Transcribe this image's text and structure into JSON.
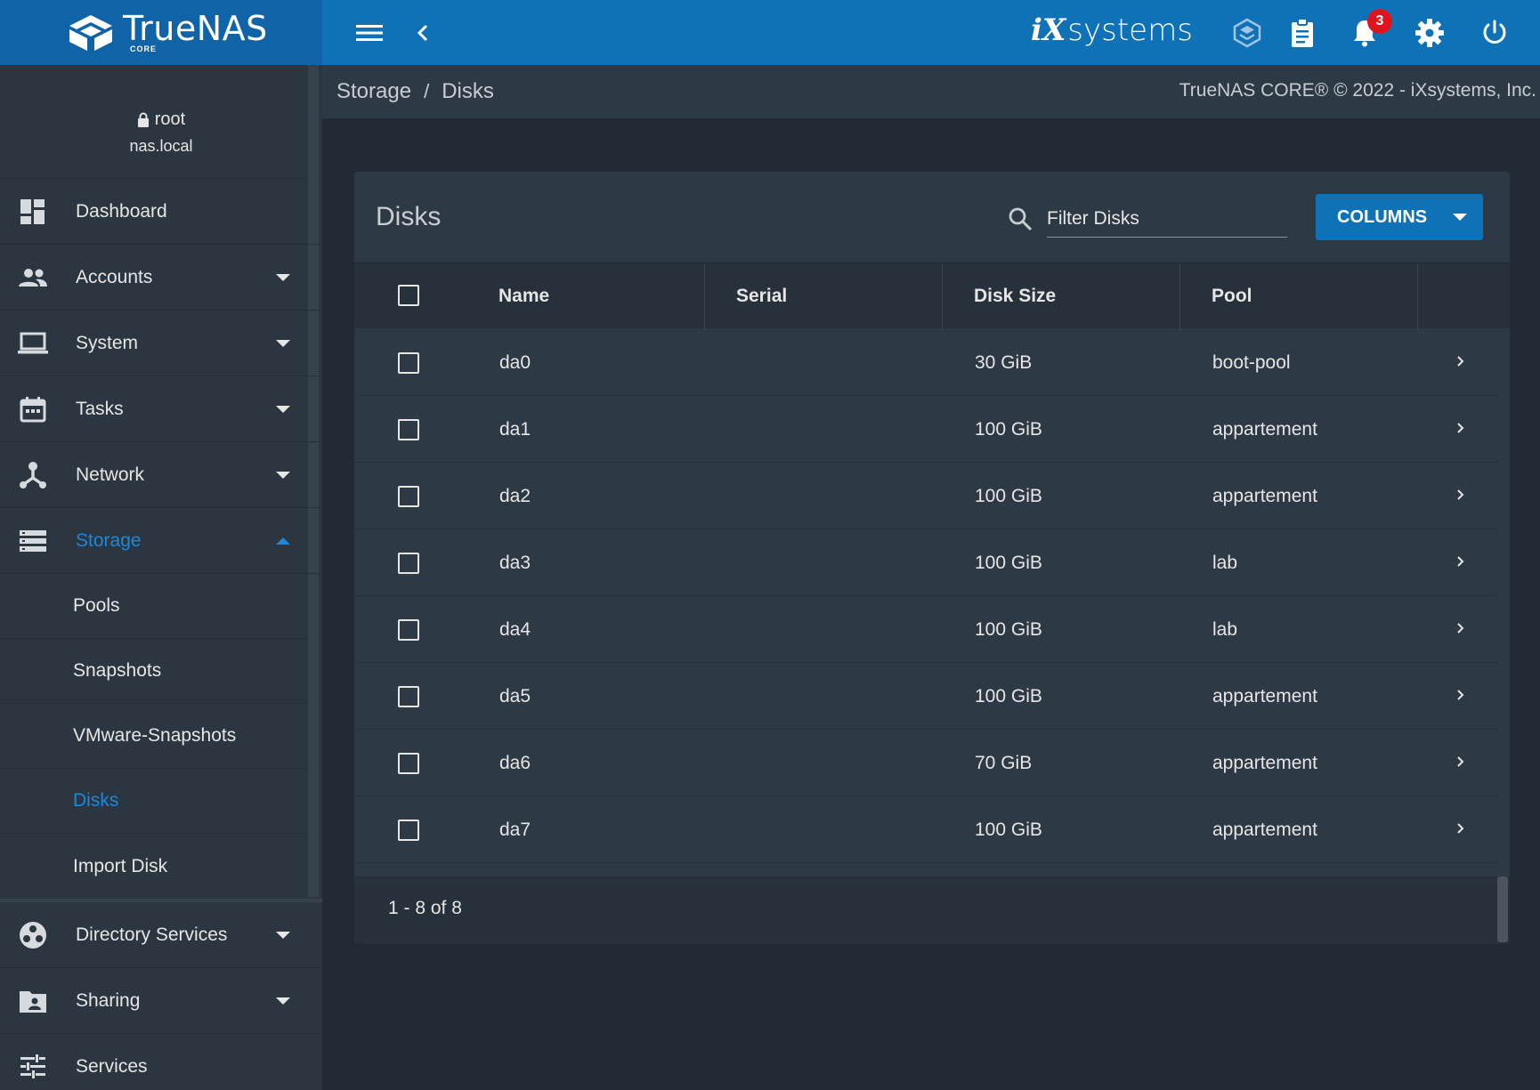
{
  "topbar": {
    "logo_text": "TrueNAS",
    "logo_sub": "CORE",
    "vendor_logo_ix": "iX",
    "vendor_logo_rest": "systems",
    "notification_count": "3"
  },
  "sidebar": {
    "user": "root",
    "host": "nas.local",
    "items": [
      {
        "label": "Dashboard",
        "icon": "dashboard-icon",
        "expandable": false
      },
      {
        "label": "Accounts",
        "icon": "people-icon",
        "expandable": true
      },
      {
        "label": "System",
        "icon": "laptop-icon",
        "expandable": true
      },
      {
        "label": "Tasks",
        "icon": "calendar-icon",
        "expandable": true
      },
      {
        "label": "Network",
        "icon": "network-icon",
        "expandable": true
      },
      {
        "label": "Storage",
        "icon": "storage-icon",
        "expandable": true,
        "active": true
      }
    ],
    "storage_sub": [
      {
        "label": "Pools"
      },
      {
        "label": "Snapshots"
      },
      {
        "label": "VMware-Snapshots"
      },
      {
        "label": "Disks",
        "active": true
      },
      {
        "label": "Import Disk"
      }
    ],
    "items_after": [
      {
        "label": "Directory Services",
        "icon": "directory-services-icon",
        "expandable": true
      },
      {
        "label": "Sharing",
        "icon": "folder-share-icon",
        "expandable": true
      },
      {
        "label": "Services",
        "icon": "tune-icon",
        "expandable": false
      }
    ]
  },
  "breadcrumb": {
    "parent": "Storage",
    "separator": "/",
    "current": "Disks",
    "copyright": "TrueNAS CORE® © 2022 - iXsystems, Inc."
  },
  "card": {
    "title": "Disks",
    "filter_placeholder": "Filter Disks",
    "columns_button": "COLUMNS"
  },
  "table": {
    "columns": [
      "Name",
      "Serial",
      "Disk Size",
      "Pool"
    ],
    "rows": [
      {
        "name": "da0",
        "serial": "",
        "size": "30 GiB",
        "pool": "boot-pool"
      },
      {
        "name": "da1",
        "serial": "",
        "size": "100 GiB",
        "pool": "appartement"
      },
      {
        "name": "da2",
        "serial": "",
        "size": "100 GiB",
        "pool": "appartement"
      },
      {
        "name": "da3",
        "serial": "",
        "size": "100 GiB",
        "pool": "lab"
      },
      {
        "name": "da4",
        "serial": "",
        "size": "100 GiB",
        "pool": "lab"
      },
      {
        "name": "da5",
        "serial": "",
        "size": "100 GiB",
        "pool": "appartement"
      },
      {
        "name": "da6",
        "serial": "",
        "size": "70 GiB",
        "pool": "appartement"
      },
      {
        "name": "da7",
        "serial": "",
        "size": "100 GiB",
        "pool": "appartement"
      }
    ],
    "range": "1 - 8 of 8"
  },
  "colors": {
    "topbar": "#0f72b7",
    "sidebar": "#2b3641",
    "background": "#222b35",
    "accent": "#1f87d8",
    "badge": "#e0141e"
  }
}
